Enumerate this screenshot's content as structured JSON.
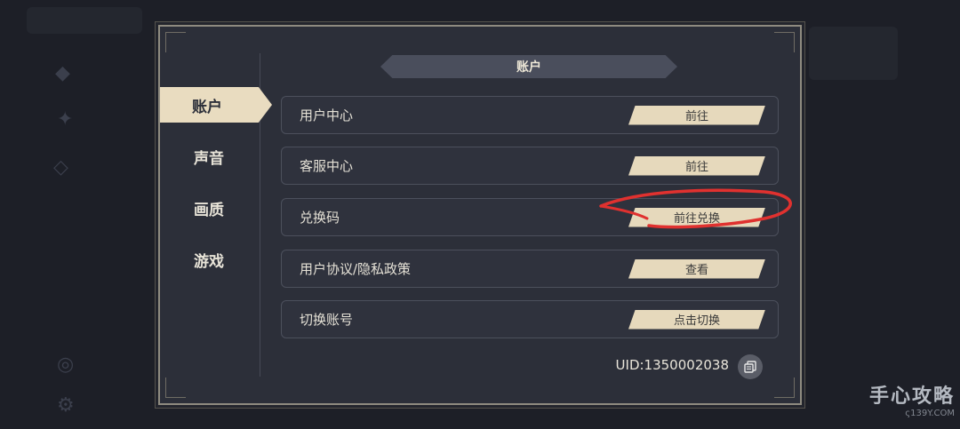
{
  "dialog": {
    "header_title": "账户",
    "tabs": [
      {
        "label": "账户",
        "active": true
      },
      {
        "label": "声音",
        "active": false
      },
      {
        "label": "画质",
        "active": false
      },
      {
        "label": "游戏",
        "active": false
      }
    ],
    "rows": [
      {
        "label": "用户中心",
        "button": "前往"
      },
      {
        "label": "客服中心",
        "button": "前往"
      },
      {
        "label": "兑换码",
        "button": "前往兑换"
      },
      {
        "label": "用户协议/隐私政策",
        "button": "查看"
      },
      {
        "label": "切换账号",
        "button": "点击切换"
      }
    ],
    "uid": "UID:1350002038"
  },
  "icons": {
    "copy": "copy-icon"
  },
  "colors": {
    "accent": "#e6d9bc",
    "panel": "#2c2f39",
    "annotation": "#e0312f"
  },
  "watermark": {
    "main": "手心攻略",
    "sub": "ς139Y.COM"
  }
}
